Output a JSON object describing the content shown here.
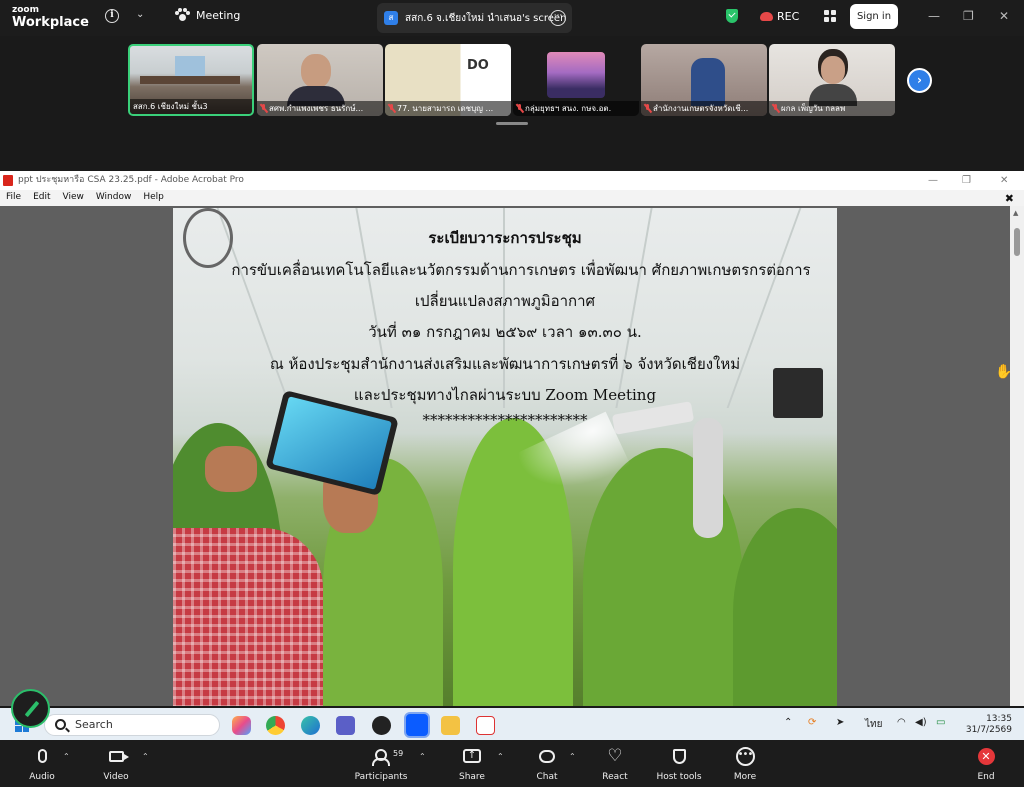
{
  "zoom": {
    "brand_line1": "zoom",
    "brand_line2": "Workplace",
    "meeting_label": "Meeting",
    "share_badge": "ส",
    "share_title": "สสก.6 จ.เชียงใหม่ นำเสนอ's screen",
    "rec_label": "REC",
    "signin_label": "Sign in",
    "thumbnails": [
      {
        "label": "สสก.6 เชียงใหม่ ชั้น3",
        "muted": false
      },
      {
        "label": "สศพ.กำแพงเพชร ธนรักษ์...",
        "muted": true
      },
      {
        "label": "77. นายสามารถ เดชบุญ ...",
        "muted": true
      },
      {
        "label": "กลุ่มยุทธฯ สนง. กษจ.อต.",
        "muted": true
      },
      {
        "label": "สำนักงานเกษตรจังหวัดเชี...",
        "muted": true
      },
      {
        "label": "ผกล เพ็ญวัน กลลพ",
        "muted": true
      }
    ],
    "toolbar": {
      "audio": "Audio",
      "video": "Video",
      "participants": "Participants",
      "participants_count": "59",
      "share": "Share",
      "chat": "Chat",
      "react": "React",
      "host_tools": "Host tools",
      "more": "More",
      "end": "End"
    }
  },
  "acrobat": {
    "window_title": "ppt ประชุมหารือ  CSA 23.25.pdf - Adobe Acrobat Pro",
    "menu": [
      "File",
      "Edit",
      "View",
      "Window",
      "Help"
    ],
    "page": {
      "lines": [
        "ระเบียบวาระการประชุม",
        "การขับเคลื่อนเทคโนโลยีและนวัตกรรมด้านการเกษตร เพื่อพัฒนา ศักยภาพเกษตรกรต่อการ",
        "เปลี่ยนแปลงสภาพภูมิอากาศ",
        "วันที่ ๓๑ กรกฎาคม ๒๕๖๙ เวลา ๑๓.๓๐ น.",
        "ณ ห้องประชุมสำนักงานส่งเสริมและพัฒนาการเกษตรที่ ๖ จังหวัดเชียงใหม่",
        "และประชุมทางไกลผ่านระบบ Zoom Meeting",
        "**********************"
      ]
    }
  },
  "taskbar": {
    "search_placeholder": "Search",
    "lang": "ไทย",
    "time": "13:35",
    "date": "31/7/2569"
  }
}
